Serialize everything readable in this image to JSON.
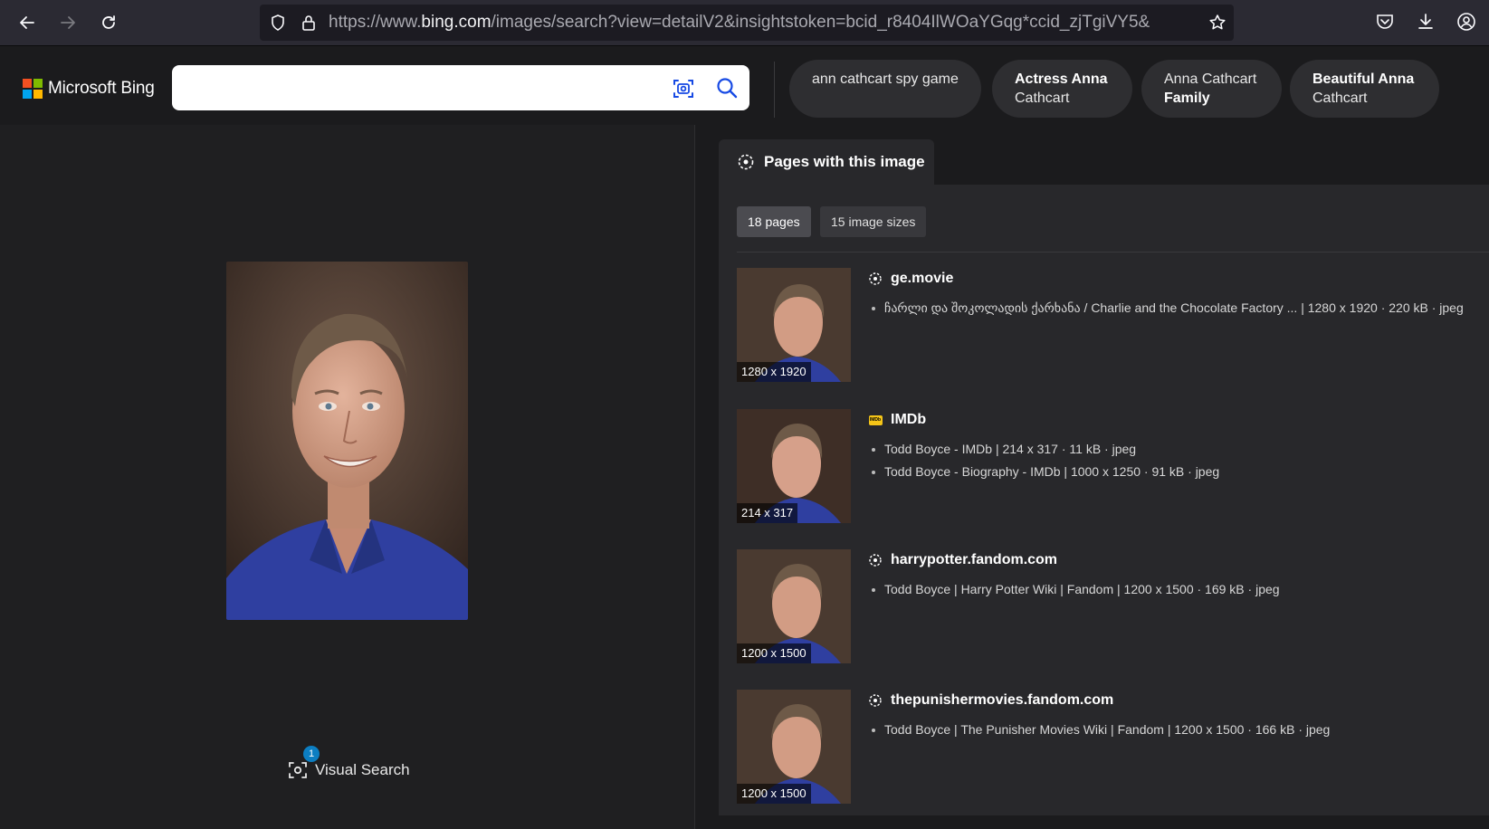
{
  "browser": {
    "url_prefix": "https://www.",
    "url_host": "bing.com",
    "url_rest": "/images/search?view=detailV2&insightstoken=bcid_r8404IlWOaYGqg*ccid_zjTgiVY5&"
  },
  "header": {
    "logo_text": "Microsoft Bing",
    "search_value": "",
    "related_chips": [
      {
        "plain": "ann cathcart spy game",
        "bold": ""
      },
      {
        "bold": "Actress Anna",
        "plain": "Cathcart"
      },
      {
        "plain": "Anna Cathcart",
        "bold": "Family"
      },
      {
        "bold": "Beautiful Anna",
        "plain": "Cathcart"
      }
    ]
  },
  "left": {
    "visual_search_label": "Visual Search",
    "visual_search_badge": "1"
  },
  "right": {
    "tab_label": "Pages with this image",
    "filters": [
      "18 pages",
      "15 image sizes"
    ],
    "results": [
      {
        "source": "ge.movie",
        "icon": "globe-icon",
        "thumb_size": "1280 x 1920",
        "lines": [
          "ჩარლი და შოკოლადის ქარხანა / Charlie and the Chocolate Factory ... | 1280 x 1920 · 220 kB · jpeg"
        ]
      },
      {
        "source": "IMDb",
        "icon": "imdb-icon",
        "thumb_size": "214 x 317",
        "lines": [
          "Todd Boyce - IMDb | 214 x 317 · 11 kB · jpeg",
          "Todd Boyce - Biography - IMDb | 1000 x 1250 · 91 kB · jpeg"
        ]
      },
      {
        "source": "harrypotter.fandom.com",
        "icon": "globe-icon",
        "thumb_size": "1200 x 1500",
        "lines": [
          "Todd Boyce | Harry Potter Wiki | Fandom | 1200 x 1500 · 169 kB · jpeg"
        ]
      },
      {
        "source": "thepunishermovies.fandom.com",
        "icon": "globe-icon",
        "thumb_size": "1200 x 1500",
        "lines": [
          "Todd Boyce | The Punisher Movies Wiki | Fandom | 1200 x 1500 · 166 kB · jpeg"
        ]
      }
    ]
  },
  "colors": {
    "page_bg": "#1b1b1d",
    "panel_bg": "#28282b",
    "accent_blue": "#0c7ec2",
    "shirt_blue": "#2f3fa0"
  }
}
